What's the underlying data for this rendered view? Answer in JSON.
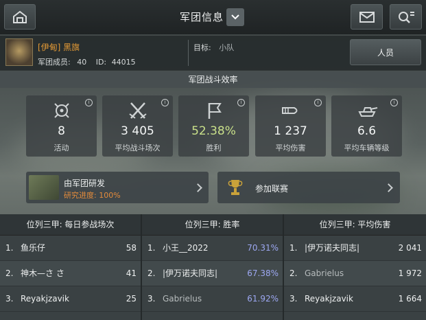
{
  "header": {
    "title": "军团信息"
  },
  "clan": {
    "name": "[伊甸] 黑旗",
    "members_label": "军团成员:",
    "members_count": "40",
    "id_label": "ID:",
    "id_value": "44015",
    "target_label": "目标:",
    "target_value": "小队",
    "members_button": "人员"
  },
  "efficiency": {
    "title": "军团战斗效率",
    "stats": [
      {
        "value": "8",
        "label": "活动",
        "icon": "target-icon"
      },
      {
        "value": "3 405",
        "label": "平均战斗场次",
        "icon": "crossed-swords-icon"
      },
      {
        "value": "52.38%",
        "label": "胜利",
        "icon": "flag-icon"
      },
      {
        "value": "1 237",
        "label": "平均伤害",
        "icon": "shell-icon"
      },
      {
        "value": "6.6",
        "label": "平均车辆等级",
        "icon": "tank-icon"
      }
    ]
  },
  "actions": {
    "research": {
      "title": "由军团研发",
      "progress": "研究进度: 100%"
    },
    "league": {
      "title": "参加联赛"
    }
  },
  "leaderboards": [
    {
      "title": "位列三甲: 每日参战场次",
      "rows": [
        {
          "rank": "1.",
          "name": "鱼乐仔",
          "value": "58"
        },
        {
          "rank": "2.",
          "name": "神木—さ さ",
          "value": "41"
        },
        {
          "rank": "3.",
          "name": "Reyakjzavik",
          "value": "25"
        }
      ]
    },
    {
      "title": "位列三甲: 胜率",
      "rows": [
        {
          "rank": "1.",
          "name": "小王__2022",
          "value": "70.31%"
        },
        {
          "rank": "2.",
          "name": "|伊万诺夫同志|",
          "value": "67.38%"
        },
        {
          "rank": "3.",
          "name": "Gabrielus",
          "value": "61.92%"
        }
      ]
    },
    {
      "title": "位列三甲: 平均伤害",
      "rows": [
        {
          "rank": "1.",
          "name": "|伊万诺夫同志|",
          "value": "2 041"
        },
        {
          "rank": "2.",
          "name": "Gabrielus",
          "value": "1 972"
        },
        {
          "rank": "3.",
          "name": "Reyakjzavik",
          "value": "1 664"
        }
      ]
    }
  ]
}
